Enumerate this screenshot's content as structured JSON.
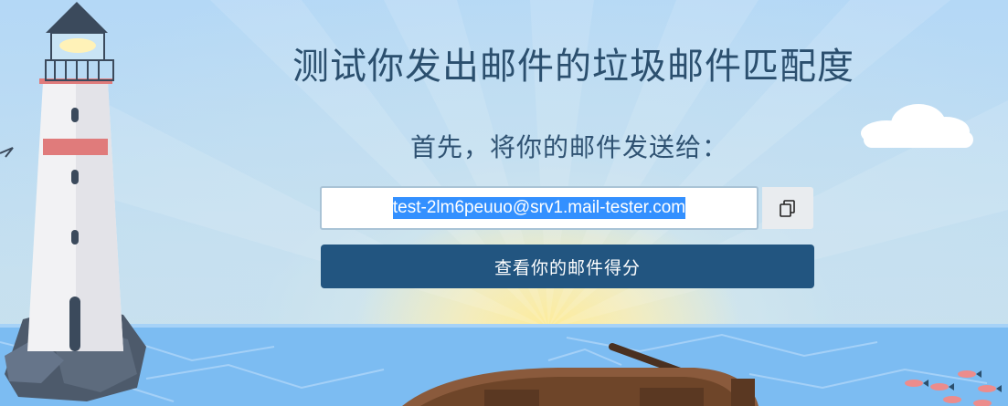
{
  "page": {
    "title": "测试你发出邮件的垃圾邮件匹配度",
    "subtitle": "首先，将你的邮件发送给："
  },
  "form": {
    "email_value": "test-2lm6peuuo@srv1.mail-tester.com",
    "copy_icon": "copy-icon",
    "submit_label": "查看你的邮件得分"
  },
  "colors": {
    "title": "#2b4f6e",
    "button": "#225580",
    "selection": "#3390ff",
    "sea": "#7ab8f0"
  }
}
